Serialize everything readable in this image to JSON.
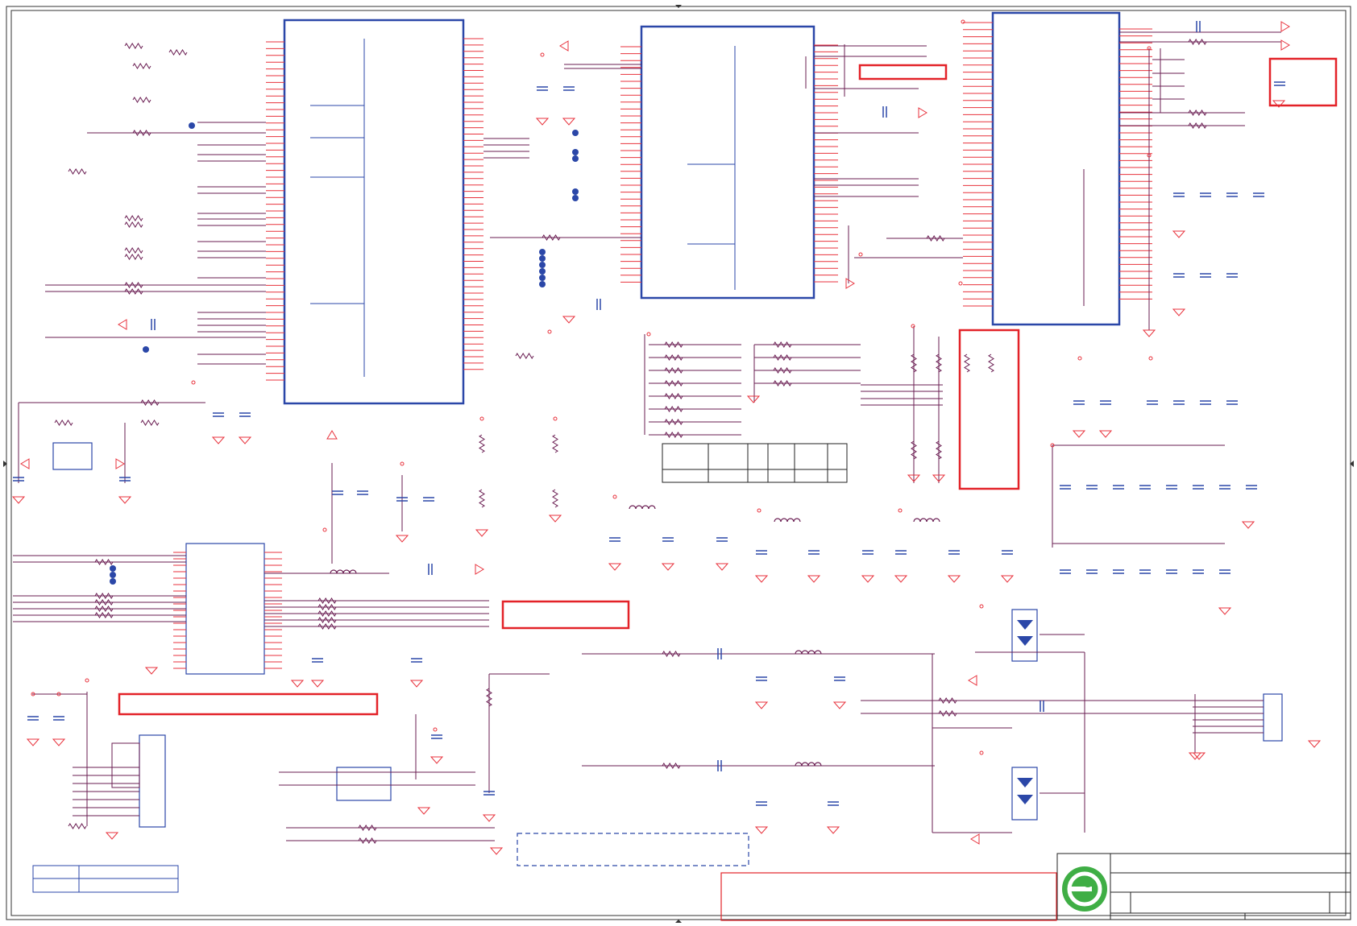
{
  "document": {
    "kind": "electronic schematic sheet",
    "text_content": []
  },
  "colors": {
    "wire": "#e8323c",
    "net": "#6a1d52",
    "component": "#2b47a8",
    "highlight_box": "#e32228",
    "junction": "#2b47a8",
    "border": "#333333",
    "logo_green": "#3fae45"
  },
  "icons": {
    "logo": "company-logo-icon",
    "diode": "tvs-diode-icon",
    "ground": "ground-symbol-icon",
    "power": "power-arrow-icon"
  }
}
